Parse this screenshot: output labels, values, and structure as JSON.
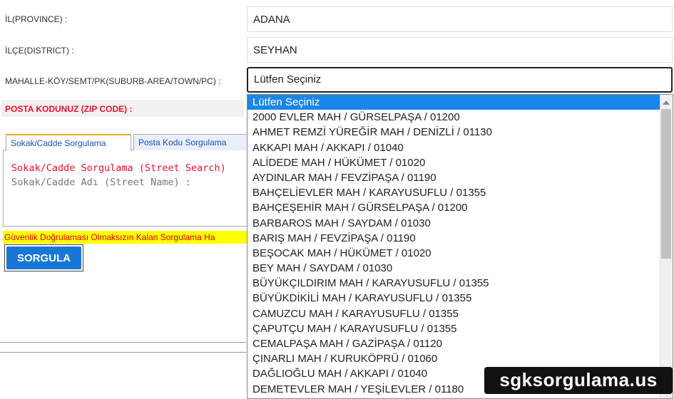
{
  "form": {
    "province_label": "İL(PROVINCE) :",
    "province_value": "ADANA",
    "district_label": "İLÇE(DISTRICT) :",
    "district_value": "SEYHAN",
    "suburb_label": "MAHALLE-KÖY/SEMT/PK(SUBURB-AREA/TOWN/PC) :",
    "suburb_value": "Lütfen Seçiniz",
    "zip_label": "POSTA KODUNUZ (ZIP CODE) :"
  },
  "tabs": [
    {
      "label": "Sokak/Cadde Sorgulama"
    },
    {
      "label": "Posta Kodu Sorgulama"
    }
  ],
  "panel": {
    "title": "Sokak/Cadde Sorgulama (Street Search)",
    "subtitle": "Sokak/Cadde Adı (Street Name) :"
  },
  "warning": "Güvenlik Doğrulaması Olmaksızın Kalan Sorgulama Ha",
  "query_button": "SORGULA",
  "dropdown": {
    "options": [
      "Lütfen Seçiniz",
      "2000 EVLER MAH / GÜRSELPAŞA / 01200",
      "AHMET REMZİ YÜREĞİR MAH / DENİZLİ / 01130",
      "AKKAPI MAH / AKKAPI / 01040",
      "ALİDEDE MAH / HÜKÜMET / 01020",
      "AYDINLAR MAH / FEVZİPAŞA / 01190",
      "BAHÇELİEVLER MAH / KARAYUSUFLU / 01355",
      "BAHÇEŞEHİR MAH / GÜRSELPAŞA / 01200",
      "BARBAROS MAH / SAYDAM / 01030",
      "BARIŞ MAH / FEVZİPAŞA / 01190",
      "BEŞOCAK MAH / HÜKÜMET / 01020",
      "BEY MAH / SAYDAM / 01030",
      "BÜYÜKÇILDIRIM MAH / KARAYUSUFLU / 01355",
      "BÜYÜKDİKİLİ MAH / KARAYUSUFLU / 01355",
      "CAMUZCU MAH / KARAYUSUFLU / 01355",
      "ÇAPUTÇU MAH / KARAYUSUFLU / 01355",
      "CEMALPAŞA MAH / GAZİPAŞA / 01120",
      "ÇINARLI MAH / KURUKÖPRÜ / 01060",
      "DAĞLIOĞLU MAH / AKKAPI / 01040",
      "DEMETEVLER MAH / YEŞİLEVLER / 01180"
    ],
    "highlight_color": "#1a86e8"
  },
  "watermark": "sgksorgulama.us"
}
